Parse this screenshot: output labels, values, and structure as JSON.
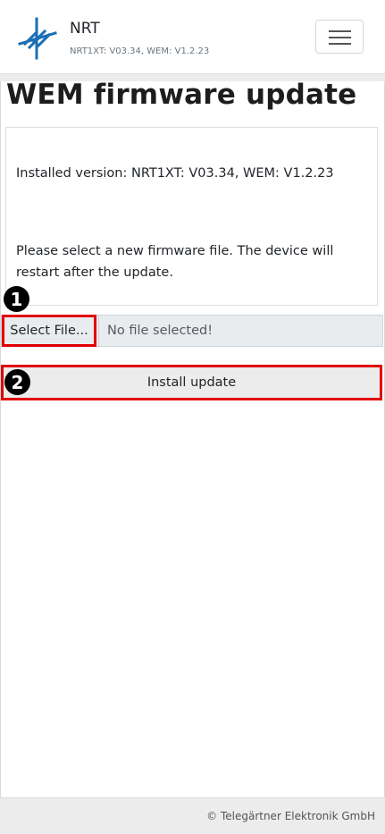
{
  "header": {
    "brand_name": "NRT",
    "brand_version": "NRT1XT: V03.34, WEM: V1.2.23",
    "logo_color": "#1a6fb5"
  },
  "page": {
    "title": "WEM firmware update"
  },
  "info": {
    "installed_version": "Installed version: NRT1XT: V03.34, WEM: V1.2.23",
    "instructions": "Please select a new firmware file. The device will restart after the update."
  },
  "file_picker": {
    "button_label": "Select File...",
    "status": "No file selected!"
  },
  "install": {
    "button_label": "Install update"
  },
  "annotations": {
    "step_one": "1",
    "step_two": "2",
    "highlight_color": "#e00000"
  },
  "footer": {
    "copyright": "© Telegärtner Elektronik GmbH"
  }
}
